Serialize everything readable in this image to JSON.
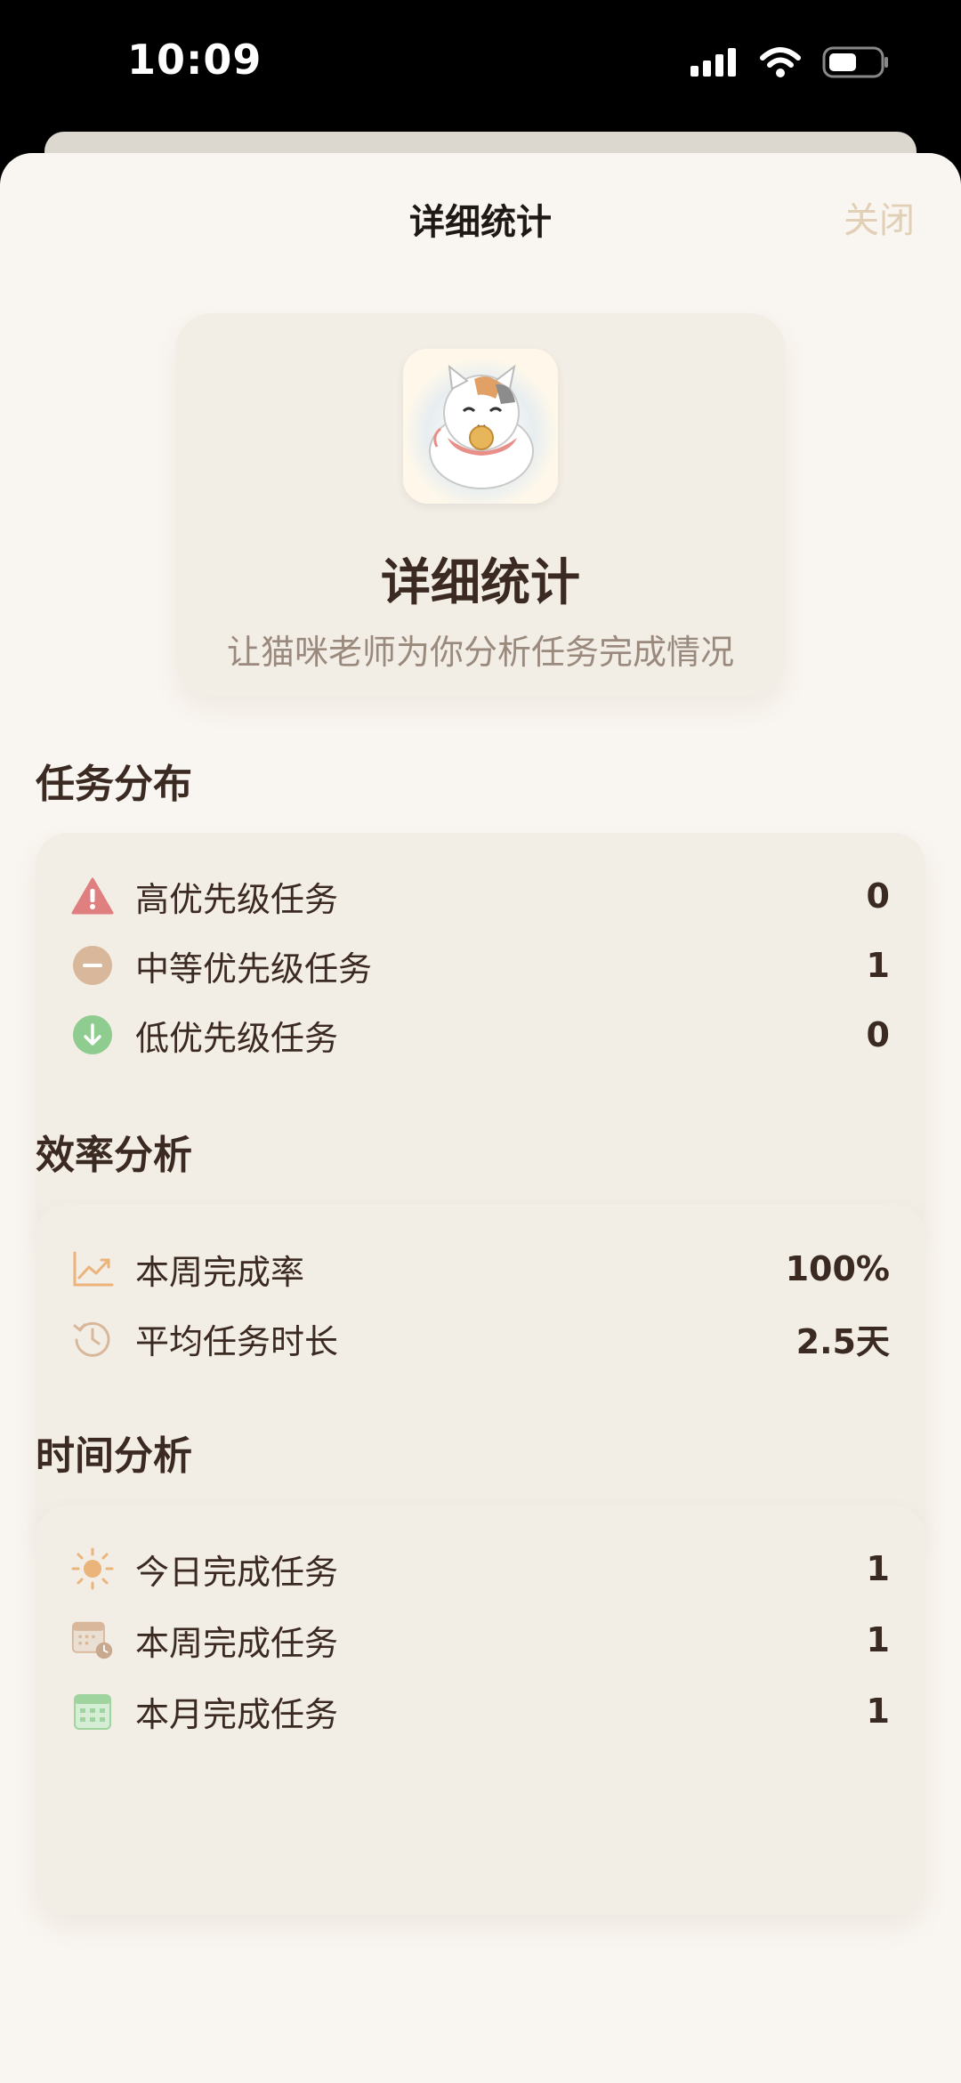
{
  "status_bar": {
    "time": "10:09"
  },
  "nav": {
    "title": "详细统计",
    "close_label": "关闭"
  },
  "hero": {
    "title": "详细统计",
    "subtitle": "让猫咪老师为你分析任务完成情况",
    "avatar_icon": "cat-teacher-avatar"
  },
  "sections": [
    {
      "title": "任务分布",
      "rows": [
        {
          "icon": "warning-triangle-icon",
          "label": "高优先级任务",
          "value": "0"
        },
        {
          "icon": "minus-circle-icon",
          "label": "中等优先级任务",
          "value": "1"
        },
        {
          "icon": "arrow-down-circle-icon",
          "label": "低优先级任务",
          "value": "0"
        }
      ]
    },
    {
      "title": "效率分析",
      "rows": [
        {
          "icon": "trend-chart-icon",
          "label": "本周完成率",
          "value": "100%"
        },
        {
          "icon": "history-clock-icon",
          "label": "平均任务时长",
          "value": "2.5天"
        }
      ]
    },
    {
      "title": "时间分析",
      "rows": [
        {
          "icon": "sun-icon",
          "label": "今日完成任务",
          "value": "1"
        },
        {
          "icon": "calendar-clock-icon",
          "label": "本周完成任务",
          "value": "1"
        },
        {
          "icon": "calendar-icon",
          "label": "本月完成任务",
          "value": "1"
        }
      ]
    }
  ],
  "colors": {
    "background": "#f9f5f0",
    "card": "#f2ede5",
    "text": "#3b2a22",
    "muted": "#9a8a7e",
    "accent_close": "#e1cfb6",
    "high": "#e07f7f",
    "medium": "#d9b79a",
    "low": "#8fcc8f",
    "orange": "#eab47a"
  }
}
